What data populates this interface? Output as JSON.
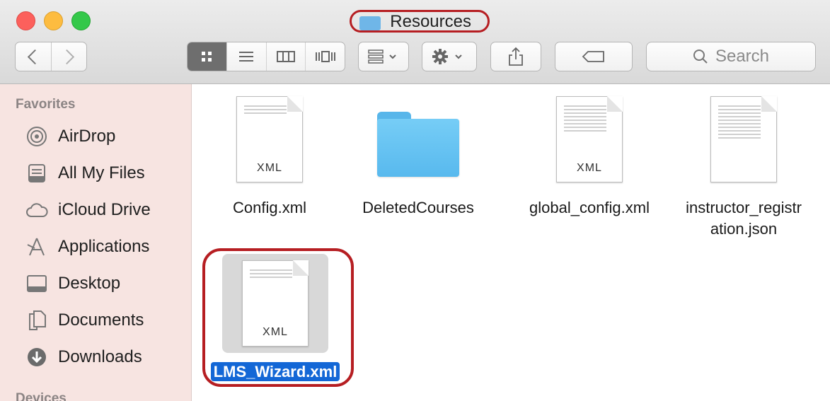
{
  "window": {
    "title": "Resources"
  },
  "toolbar": {
    "back_icon": "chevron-left-icon",
    "forward_icon": "chevron-right-icon",
    "view_modes": [
      "icon-view",
      "list-view",
      "column-view",
      "cover-flow-view"
    ],
    "active_view": "icon-view",
    "search": {
      "label": "Search"
    }
  },
  "sidebar": {
    "section_favorites": "Favorites",
    "items": [
      {
        "label": "AirDrop",
        "icon": "airdrop-icon"
      },
      {
        "label": "All My Files",
        "icon": "all-files-icon"
      },
      {
        "label": "iCloud Drive",
        "icon": "cloud-icon"
      },
      {
        "label": "Applications",
        "icon": "applications-icon"
      },
      {
        "label": "Desktop",
        "icon": "desktop-icon"
      },
      {
        "label": "Documents",
        "icon": "documents-icon"
      },
      {
        "label": "Downloads",
        "icon": "downloads-icon"
      }
    ],
    "section_devices": "Devices"
  },
  "files": [
    {
      "name": "Config.xml",
      "kind": "XML"
    },
    {
      "name": "DeletedCourses",
      "kind": "folder"
    },
    {
      "name": "global_config.xml",
      "kind": "XML"
    },
    {
      "name_line1": "instructor_registr",
      "name_line2": "ation.json",
      "kind": "json"
    },
    {
      "name": "LMS_Wizard.xml",
      "kind": "XML",
      "selected": true
    }
  ],
  "colors": {
    "sidebar_bg": "#f7e4e1",
    "selection": "#1367d6",
    "annotation": "#b61e22",
    "folder": "#6cc6f3"
  }
}
